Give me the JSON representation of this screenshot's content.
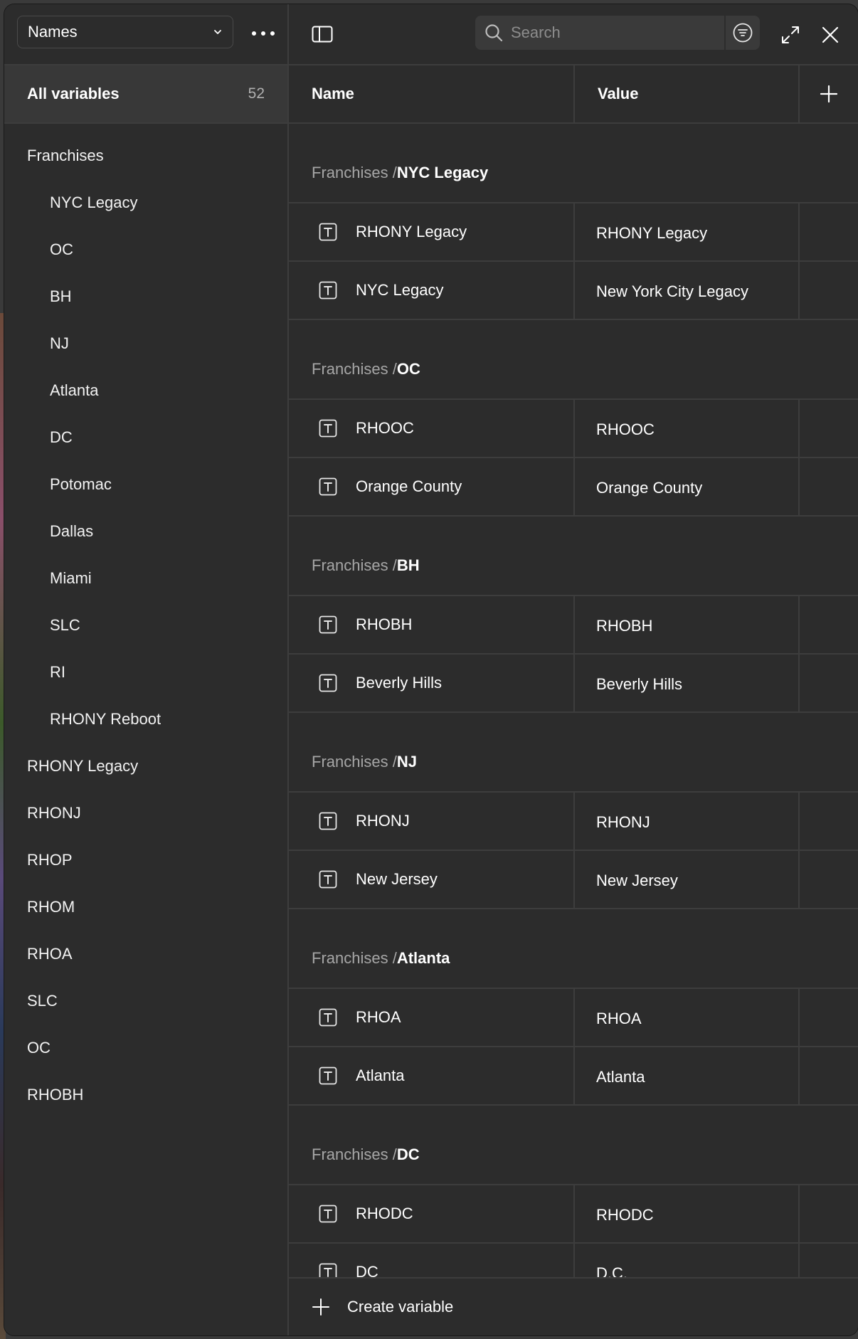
{
  "sidebar": {
    "collection": "Names",
    "all_variables": {
      "label": "All variables",
      "count": "52"
    },
    "groups": [
      {
        "label": "Franchises",
        "level": 0
      },
      {
        "label": "NYC Legacy",
        "level": 1
      },
      {
        "label": "OC",
        "level": 1
      },
      {
        "label": "BH",
        "level": 1
      },
      {
        "label": "NJ",
        "level": 1
      },
      {
        "label": "Atlanta",
        "level": 1
      },
      {
        "label": "DC",
        "level": 1
      },
      {
        "label": "Potomac",
        "level": 1
      },
      {
        "label": "Dallas",
        "level": 1
      },
      {
        "label": "Miami",
        "level": 1
      },
      {
        "label": "SLC",
        "level": 1
      },
      {
        "label": "RI",
        "level": 1
      },
      {
        "label": "RHONY Reboot",
        "level": 1
      },
      {
        "label": "RHONY Legacy",
        "level": 0
      },
      {
        "label": "RHONJ",
        "level": 0
      },
      {
        "label": "RHOP",
        "level": 0
      },
      {
        "label": "RHOM",
        "level": 0
      },
      {
        "label": "RHOA",
        "level": 0
      },
      {
        "label": "SLC",
        "level": 0
      },
      {
        "label": "OC",
        "level": 0
      },
      {
        "label": "RHOBH",
        "level": 0
      }
    ]
  },
  "toolbar": {
    "search_placeholder": "Search"
  },
  "table": {
    "columns": {
      "name": "Name",
      "value": "Value"
    },
    "sections": [
      {
        "path": "Franchises / ",
        "leaf": "NYC Legacy",
        "rows": [
          {
            "name": "RHONY Legacy",
            "value": "RHONY Legacy"
          },
          {
            "name": "NYC Legacy",
            "value": "New York City Legacy"
          }
        ]
      },
      {
        "path": "Franchises / ",
        "leaf": "OC",
        "rows": [
          {
            "name": "RHOOC",
            "value": "RHOOC"
          },
          {
            "name": "Orange County",
            "value": "Orange County"
          }
        ]
      },
      {
        "path": "Franchises / ",
        "leaf": "BH",
        "rows": [
          {
            "name": "RHOBH",
            "value": "RHOBH"
          },
          {
            "name": "Beverly Hills",
            "value": "Beverly Hills"
          }
        ]
      },
      {
        "path": "Franchises / ",
        "leaf": "NJ",
        "rows": [
          {
            "name": "RHONJ",
            "value": "RHONJ"
          },
          {
            "name": "New Jersey",
            "value": "New Jersey"
          }
        ]
      },
      {
        "path": "Franchises / ",
        "leaf": "Atlanta",
        "rows": [
          {
            "name": "RHOA",
            "value": "RHOA"
          },
          {
            "name": "Atlanta",
            "value": "Atlanta"
          }
        ]
      },
      {
        "path": "Franchises / ",
        "leaf": "DC",
        "rows": [
          {
            "name": "RHODC",
            "value": "RHODC"
          },
          {
            "name": "DC",
            "value": "D.C."
          }
        ]
      }
    ]
  },
  "footer": {
    "create_label": "Create variable"
  },
  "icons": {
    "type": "text-type-icon"
  },
  "colors": {
    "panel": "#2c2c2c",
    "border": "#3d3d3d",
    "selected": "#383838",
    "muted": "#a6a6a6"
  }
}
